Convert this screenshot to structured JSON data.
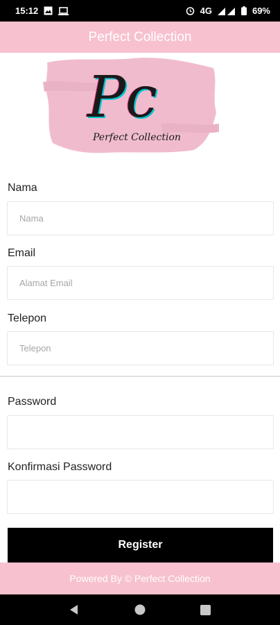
{
  "status_bar": {
    "time": "15:12",
    "network": "4G",
    "battery": "69%",
    "icons_left": [
      "image-icon",
      "laptop-icon"
    ],
    "icons_right": [
      "alarm-icon",
      "signal-icon",
      "battery-icon"
    ]
  },
  "app_bar": {
    "title": "Perfect Collection"
  },
  "logo": {
    "monogram": "Pc",
    "wordmark": "Perfect Collection",
    "brush_color": "#f0bccd"
  },
  "form": {
    "name": {
      "label": "Nama",
      "placeholder": "Nama",
      "value": ""
    },
    "email": {
      "label": "Email",
      "placeholder": "Alamat Email",
      "value": ""
    },
    "phone": {
      "label": "Telepon",
      "placeholder": "Telepon",
      "value": ""
    },
    "password": {
      "label": "Password",
      "placeholder": "",
      "value": ""
    },
    "confirm_password": {
      "label": "Konfirmasi Password",
      "placeholder": "",
      "value": ""
    }
  },
  "register_button": {
    "label": "Register"
  },
  "footer": {
    "text": "Powered By © Perfect Collection"
  },
  "nav_bar": {
    "buttons": [
      "back-icon",
      "home-icon",
      "recents-icon"
    ]
  },
  "colors": {
    "accent_pink": "#f7c1cf",
    "button_black": "#000000"
  }
}
